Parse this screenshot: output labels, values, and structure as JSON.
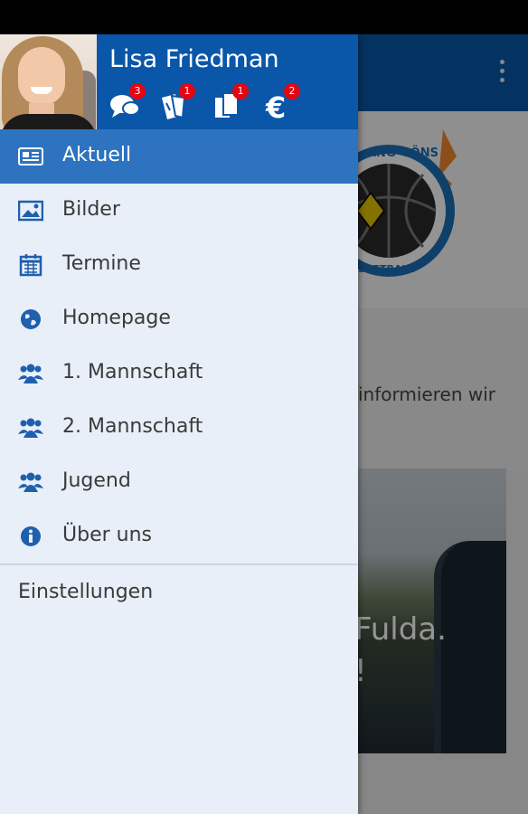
{
  "colors": {
    "primary": "#0a56a8",
    "active_row": "#2d73bf",
    "drawer_bg": "#e8eff8",
    "badge": "#e30613",
    "icon": "#1e5fae"
  },
  "user": {
    "name": "Lisa Friedman"
  },
  "stats": [
    {
      "icon": "chat-bubbles-icon",
      "count": "3"
    },
    {
      "icon": "tickets-icon",
      "count": "1"
    },
    {
      "icon": "documents-icon",
      "count": "1"
    },
    {
      "icon": "euro-icon",
      "count": "2"
    }
  ],
  "menu": {
    "items": [
      {
        "label": "Aktuell",
        "icon": "news-icon",
        "active": true
      },
      {
        "label": "Bilder",
        "icon": "image-icon",
        "active": false
      },
      {
        "label": "Termine",
        "icon": "calendar-icon",
        "active": false
      },
      {
        "label": "Homepage",
        "icon": "globe-icon",
        "active": false
      },
      {
        "label": "1. Mannschaft",
        "icon": "team-icon",
        "active": false
      },
      {
        "label": "2. Mannschaft",
        "icon": "team-icon",
        "active": false
      },
      {
        "label": "Jugend",
        "icon": "team-icon",
        "active": false
      },
      {
        "label": "Über uns",
        "icon": "info-icon",
        "active": false
      }
    ],
    "settings_label": "Einstellungen"
  },
  "background": {
    "logo_top_text": "ANG-GÖNS",
    "logo_bottom_text": "SKETBALL",
    "content_line1": "informieren wir",
    "content_line2": "-",
    "photo_caption1": "Fulda.",
    "photo_caption2": "!"
  }
}
